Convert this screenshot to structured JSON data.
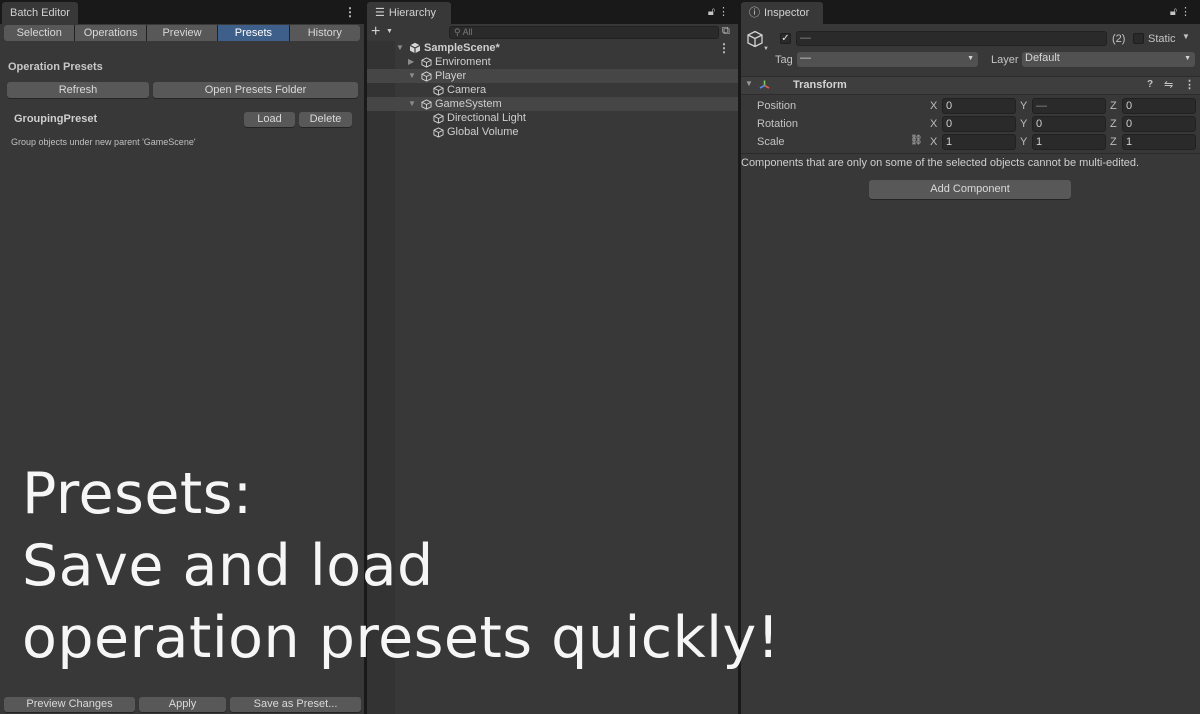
{
  "batch": {
    "tab": "Batch Editor",
    "seg_tabs": [
      "Selection",
      "Operations",
      "Preview",
      "Presets",
      "History"
    ],
    "active_tab": "Presets",
    "section_title": "Operation Presets",
    "refresh_label": "Refresh",
    "open_folder_label": "Open Presets Folder",
    "preset": {
      "name": "GroupingPreset",
      "load_label": "Load",
      "delete_label": "Delete",
      "description": "Group objects under new parent 'GameScene'"
    },
    "footer": {
      "preview_label": "Preview Changes",
      "apply_label": "Apply",
      "save_label": "Save as Preset..."
    }
  },
  "promo": {
    "line1": "Presets:",
    "line2": "Save and load",
    "line3": "operation presets quickly!"
  },
  "hierarchy": {
    "tab": "Hierarchy",
    "search_placeholder": "All",
    "items": [
      {
        "label": "SampleScene*",
        "depth": 0,
        "kind": "scene",
        "expanded": true,
        "selected": false
      },
      {
        "label": "Enviroment",
        "depth": 1,
        "kind": "object",
        "expanded": false,
        "selected": false
      },
      {
        "label": "Player",
        "depth": 1,
        "kind": "object",
        "expanded": true,
        "selected": true
      },
      {
        "label": "Camera",
        "depth": 2,
        "kind": "object",
        "selected": false
      },
      {
        "label": "GameSystem",
        "depth": 1,
        "kind": "object",
        "expanded": true,
        "selected": true
      },
      {
        "label": "Directional Light",
        "depth": 2,
        "kind": "object",
        "selected": false
      },
      {
        "label": "Global Volume",
        "depth": 2,
        "kind": "object",
        "selected": false
      }
    ]
  },
  "inspector": {
    "tab": "Inspector",
    "name_value": "—",
    "count": "(2)",
    "static_label": "Static",
    "tag_label": "Tag",
    "tag_value": "—",
    "layer_label": "Layer",
    "layer_value": "Default",
    "component": "Transform",
    "rows": [
      {
        "label": "Position",
        "x": "0",
        "y": "—",
        "z": "0"
      },
      {
        "label": "Rotation",
        "x": "0",
        "y": "0",
        "z": "0"
      },
      {
        "label": "Scale",
        "x": "1",
        "y": "1",
        "z": "1"
      }
    ],
    "axes": [
      "X",
      "Y",
      "Z"
    ],
    "note": "Components that are only on some of the selected objects cannot be multi-edited.",
    "add_component_label": "Add Component"
  }
}
